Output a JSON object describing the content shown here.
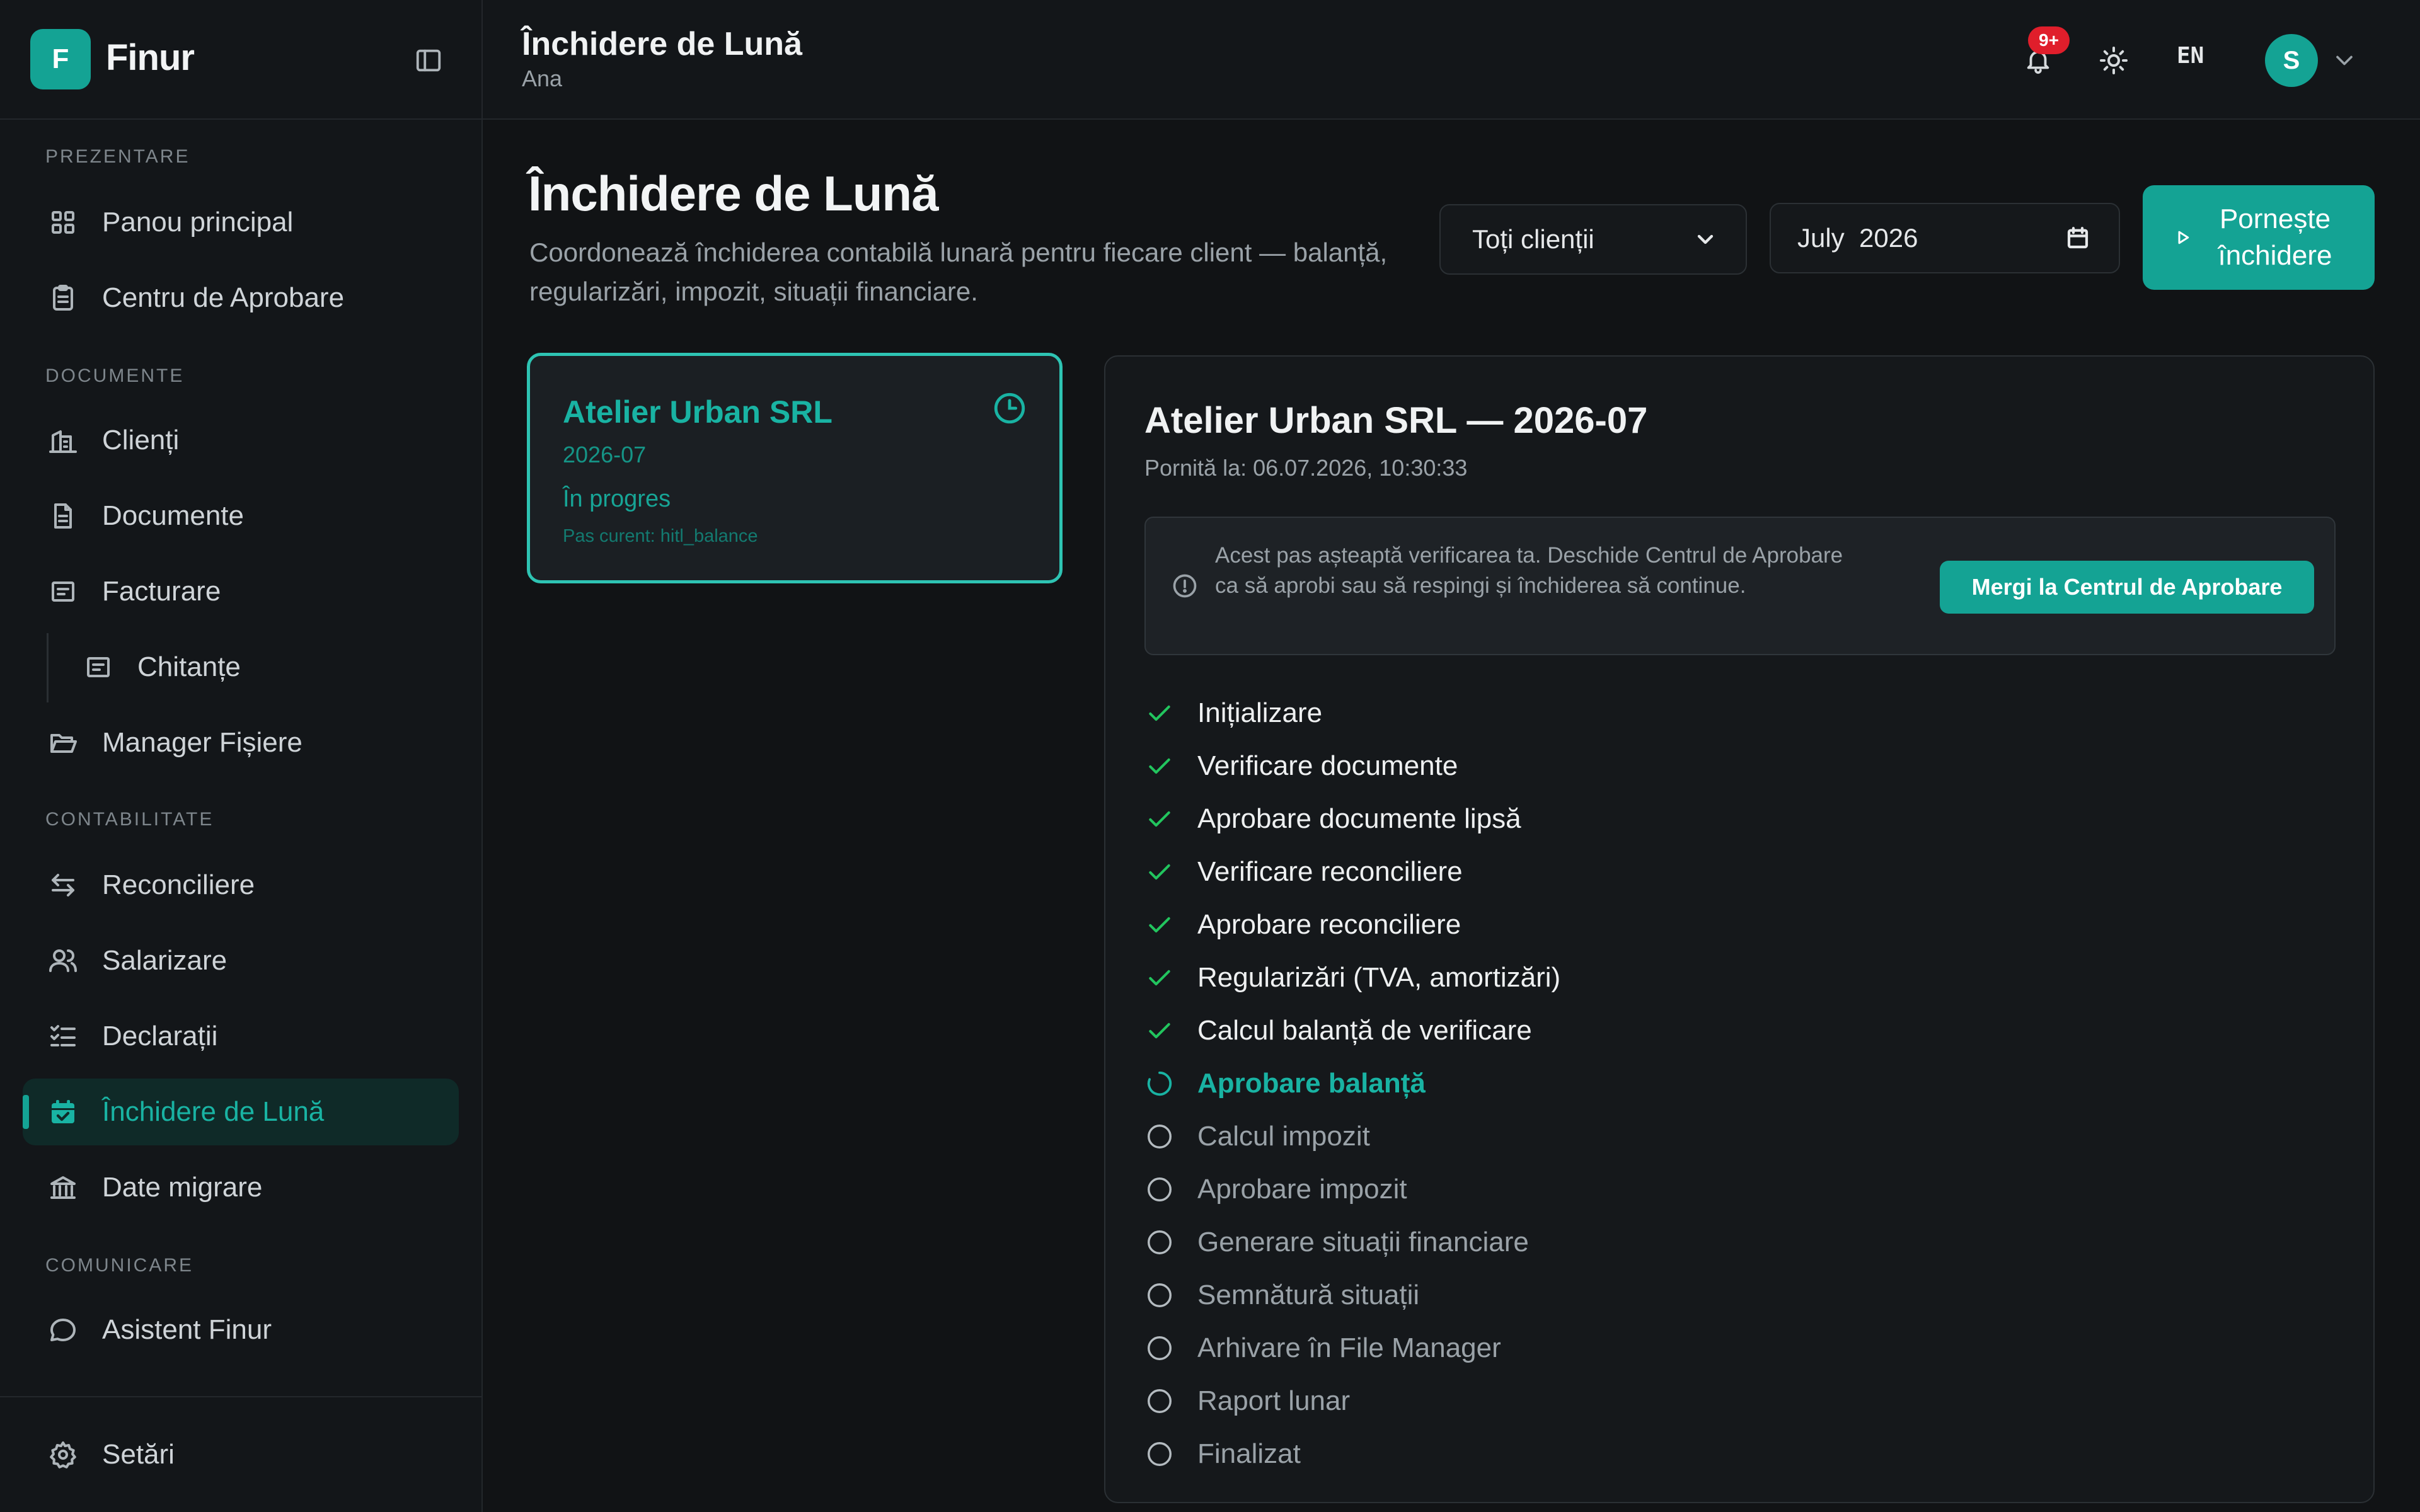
{
  "app": {
    "logo_letter": "F",
    "name": "Finur"
  },
  "sidebar": {
    "sections": [
      {
        "label": "PREZENTARE"
      },
      {
        "label": "DOCUMENTE"
      },
      {
        "label": "CONTABILITATE"
      },
      {
        "label": "COMUNICARE"
      }
    ],
    "items": [
      {
        "label": "Panou principal",
        "icon": "grid-icon"
      },
      {
        "label": "Centru de Aprobare",
        "icon": "clipboard-check-icon"
      },
      {
        "label": "Clienți",
        "icon": "building-icon"
      },
      {
        "label": "Documente",
        "icon": "file-icon"
      },
      {
        "label": "Facturare",
        "icon": "receipt-icon"
      },
      {
        "label": "Chitanțe",
        "icon": "receipt-text-icon"
      },
      {
        "label": "Manager Fișiere",
        "icon": "folder-open-icon"
      },
      {
        "label": "Reconciliere",
        "icon": "arrows-swap-icon"
      },
      {
        "label": "Salarizare",
        "icon": "users-icon"
      },
      {
        "label": "Declarații",
        "icon": "list-checks-icon"
      },
      {
        "label": "Închidere de Lună",
        "icon": "calendar-check-icon",
        "active": true
      },
      {
        "label": "Date migrare",
        "icon": "bank-icon"
      },
      {
        "label": "Asistent Finur",
        "icon": "chat-bubble-icon"
      }
    ],
    "footer": {
      "label": "Setări",
      "icon": "gear-icon"
    }
  },
  "topbar": {
    "title": "Închidere de Lună",
    "subtitle": "Ana",
    "notifications_badge": "9+",
    "language": "EN",
    "avatar_letter": "S"
  },
  "page": {
    "title": "Închidere de Lună",
    "description": "Coordonează închiderea contabilă lunară pentru fiecare client — balanță, regularizări, impozit, situații financiare.",
    "client_filter": {
      "selected": "Toți clienții"
    },
    "period": {
      "value": "July  2026"
    },
    "start_button": "Pornește închidere"
  },
  "client_card": {
    "name": "Atelier Urban SRL",
    "period": "2026-07",
    "status": "În progres",
    "current_step": "Pas curent: hitl_balance"
  },
  "detail": {
    "title": "Atelier Urban SRL — 2026-07",
    "started_at": "Pornită la: 06.07.2026, 10:30:33",
    "alert_text": "Acest pas așteaptă verificarea ta. Deschide Centrul de Aprobare ca să aprobi sau să respingi și închiderea să continue.",
    "alert_button": "Mergi la Centrul de Aprobare",
    "steps": [
      {
        "label": "Inițializare",
        "status": "done"
      },
      {
        "label": "Verificare documente",
        "status": "done"
      },
      {
        "label": "Aprobare documente lipsă",
        "status": "done"
      },
      {
        "label": "Verificare reconciliere",
        "status": "done"
      },
      {
        "label": "Aprobare reconciliere",
        "status": "done"
      },
      {
        "label": "Regularizări (TVA, amortizări)",
        "status": "done"
      },
      {
        "label": "Calcul balanță de verificare",
        "status": "done"
      },
      {
        "label": "Aprobare balanță",
        "status": "current"
      },
      {
        "label": "Calcul impozit",
        "status": "pending"
      },
      {
        "label": "Aprobare impozit",
        "status": "pending"
      },
      {
        "label": "Generare situații financiare",
        "status": "pending"
      },
      {
        "label": "Semnătură situații",
        "status": "pending"
      },
      {
        "label": "Arhivare în File Manager",
        "status": "pending"
      },
      {
        "label": "Raport lunar",
        "status": "pending"
      },
      {
        "label": "Finalizat",
        "status": "pending"
      }
    ]
  },
  "colors": {
    "accent": "#14a394",
    "done": "#22c55e",
    "badge": "#e01e2b",
    "background": "#111315"
  }
}
